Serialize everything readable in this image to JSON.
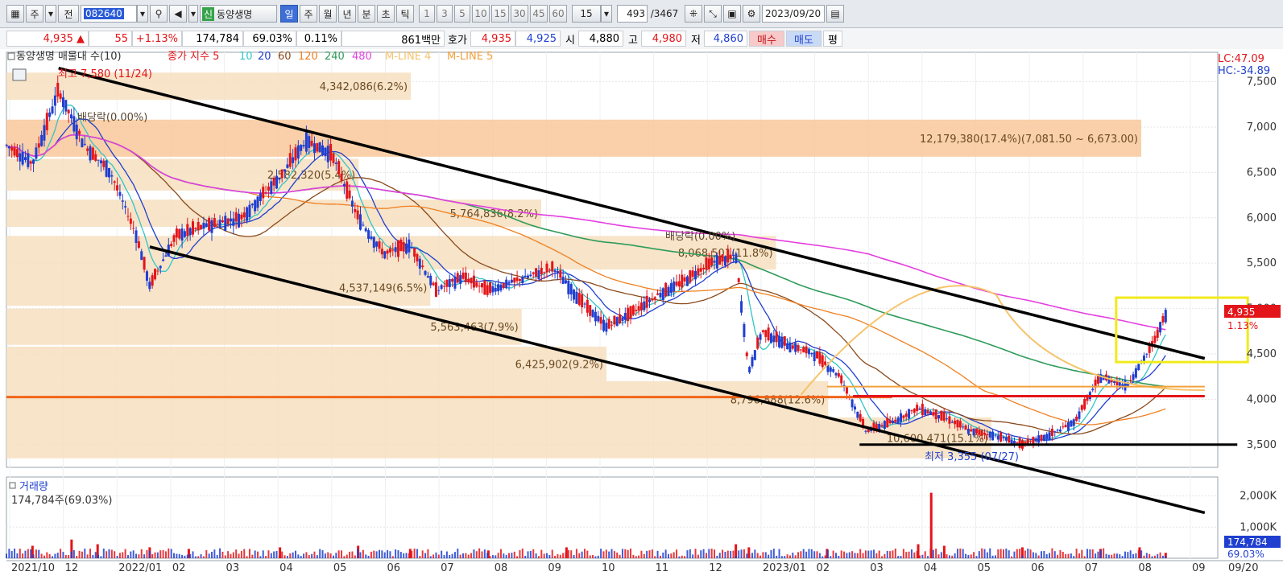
{
  "toolbar": {
    "btn_ju": "주",
    "btn_jeon": "전",
    "code": "082640",
    "name": "동양생명",
    "periods": [
      "일",
      "주",
      "월",
      "년",
      "분",
      "초",
      "틱"
    ],
    "ticks": [
      "1",
      "3",
      "5",
      "10",
      "15",
      "30",
      "45",
      "60"
    ],
    "interval": "15",
    "count": "493",
    "total": "/3467",
    "date": "2023/09/20"
  },
  "quote": {
    "price": "4,935",
    "arrow": "▲",
    "change": "55",
    "change_pct": "+1.13%",
    "volume": "174,784",
    "vol_ratio": "69.03%",
    "turnover": "0.11%",
    "amount": "861백만",
    "hoga_label": "호가",
    "ask": "4,935",
    "bid": "4,925",
    "open_label": "시",
    "open": "4,880",
    "high_label": "고",
    "high": "4,980",
    "low_label": "저",
    "low": "4,860",
    "buy": "매수",
    "sell": "매도",
    "eval": "평"
  },
  "legend": {
    "title": "동양생명 매물대 수(10)",
    "close_label": "종가 지수 5",
    "ma10": "10",
    "ma20": "20",
    "ma60": "60",
    "ma120": "120",
    "ma240": "240",
    "ma480": "480",
    "mline4": "M-LINE 4",
    "mline5": "M-LINE 5",
    "lc": "LC:47.09",
    "hc": "HC:-34.89",
    "current_price": "4,935",
    "current_pct": "1.13%"
  },
  "annotations": {
    "high_mark": "최고 7,580 (11/24)",
    "low_mark": "최저 3,355 (07/27)",
    "div1": "배당락(0.00%)",
    "div2": "배당락(0.00%)"
  },
  "volume_panel": {
    "title": "거래량",
    "value": "174,784주(69.03%)",
    "current": "174,784",
    "current_pct": "69.03%"
  },
  "chart_data": {
    "type": "candlestick",
    "x_ticks": [
      "2021/10",
      "12",
      "2022/01",
      "02",
      "03",
      "04",
      "05",
      "06",
      "07",
      "08",
      "09",
      "10",
      "11",
      "12",
      "2023/01",
      "02",
      "03",
      "04",
      "05",
      "06",
      "07",
      "08",
      "09",
      "09/20"
    ],
    "y_ticks": [
      "7,500",
      "7,000",
      "6,500",
      "6,000",
      "5,500",
      "5,000",
      "4,500",
      "4,000",
      "3,500"
    ],
    "ylim": [
      3250,
      7700
    ],
    "volume_ticks": [
      "2,000K",
      "1,000K"
    ],
    "volume_ylim": [
      0,
      2400000
    ],
    "price_path": [
      [
        0,
        6800
      ],
      [
        2,
        6600
      ],
      [
        4,
        7400
      ],
      [
        6,
        6800
      ],
      [
        8,
        6500
      ],
      [
        10,
        5800
      ],
      [
        11,
        5250
      ],
      [
        13,
        5800
      ],
      [
        15,
        5900
      ],
      [
        18,
        6000
      ],
      [
        21,
        6450
      ],
      [
        23,
        6850
      ],
      [
        25,
        6700
      ],
      [
        27,
        6000
      ],
      [
        29,
        5600
      ],
      [
        31,
        5700
      ],
      [
        33,
        5200
      ],
      [
        35,
        5350
      ],
      [
        37,
        5200
      ],
      [
        40,
        5350
      ],
      [
        42,
        5450
      ],
      [
        44,
        5100
      ],
      [
        46,
        4800
      ],
      [
        48,
        4950
      ],
      [
        50,
        5150
      ],
      [
        52,
        5300
      ],
      [
        54,
        5500
      ],
      [
        56,
        5580
      ],
      [
        57,
        4300
      ],
      [
        58,
        4750
      ],
      [
        60,
        4600
      ],
      [
        62,
        4500
      ],
      [
        64,
        4250
      ],
      [
        66,
        3650
      ],
      [
        68,
        3750
      ],
      [
        70,
        3900
      ],
      [
        72,
        3800
      ],
      [
        74,
        3650
      ],
      [
        76,
        3600
      ],
      [
        78,
        3500
      ],
      [
        80,
        3600
      ],
      [
        82,
        3750
      ],
      [
        84,
        4250
      ],
      [
        86,
        4150
      ],
      [
        88,
        4600
      ],
      [
        89,
        4935
      ]
    ],
    "volume_bars": [
      [
        2,
        400000
      ],
      [
        5,
        600000
      ],
      [
        7,
        450000
      ],
      [
        11,
        350000
      ],
      [
        14,
        300000
      ],
      [
        21,
        350000
      ],
      [
        27,
        400000
      ],
      [
        31,
        300000
      ],
      [
        37,
        250000
      ],
      [
        43,
        350000
      ],
      [
        56,
        450000
      ],
      [
        57,
        350000
      ],
      [
        63,
        300000
      ],
      [
        70,
        450000
      ],
      [
        71,
        2100000
      ],
      [
        72,
        400000
      ],
      [
        78,
        350000
      ],
      [
        84,
        300000
      ],
      [
        87,
        350000
      ],
      [
        89,
        174784
      ]
    ],
    "volume_profile": [
      {
        "label": "4,342,086(6.2%)",
        "range": [
          7300,
          7600
        ]
      },
      {
        "label": "12,179,380(17.4%)(7,081.50 ~ 6,673.00)",
        "range": [
          6673,
          7081.5
        ]
      },
      {
        "label": "2,582,320(5.4%)",
        "range": [
          6300,
          6650
        ]
      },
      {
        "label": "5,764,836(8.2%)",
        "range": [
          5900,
          6200
        ]
      },
      {
        "label": "8,068,501(11.8%)",
        "range": [
          5430,
          5800
        ]
      },
      {
        "label": "4,537,149(6.5%)",
        "range": [
          5030,
          5430
        ]
      },
      {
        "label": "5,563,463(7.9%)",
        "range": [
          4600,
          5000
        ]
      },
      {
        "label": "6,425,902(9.2%)",
        "range": [
          4200,
          4580
        ]
      },
      {
        "label": "8,796,888(12.6%)",
        "range": [
          3800,
          4200
        ]
      },
      {
        "label": "10,600,471(15.1%)",
        "range": [
          3350,
          3800
        ]
      }
    ],
    "trendlines": [
      {
        "from": [
          4,
          7650
        ],
        "to": [
          92,
          4450
        ]
      },
      {
        "from": [
          11,
          5680
        ],
        "to": [
          92,
          2750
        ]
      }
    ],
    "series": [
      {
        "name": "10",
        "color": "#31c5c5"
      },
      {
        "name": "20",
        "color": "#1f3fd0"
      },
      {
        "name": "60",
        "color": "#8b4a1c"
      },
      {
        "name": "120",
        "color": "#f07f1f"
      },
      {
        "name": "240",
        "color": "#2f9b5a"
      },
      {
        "name": "480",
        "color": "#e43fe0"
      },
      {
        "name": "M-LINE 4",
        "color": "#f6c36a"
      },
      {
        "name": "M-LINE 5",
        "color": "#f3a13a"
      }
    ],
    "colors": {
      "up": "#e3151a",
      "down": "#1f3fd0",
      "profile": "#f6dfc0",
      "profile_max": "#f8c89a",
      "trend": "#000000",
      "highlight_box": "#f1ea1a",
      "support": "#f06418"
    }
  }
}
